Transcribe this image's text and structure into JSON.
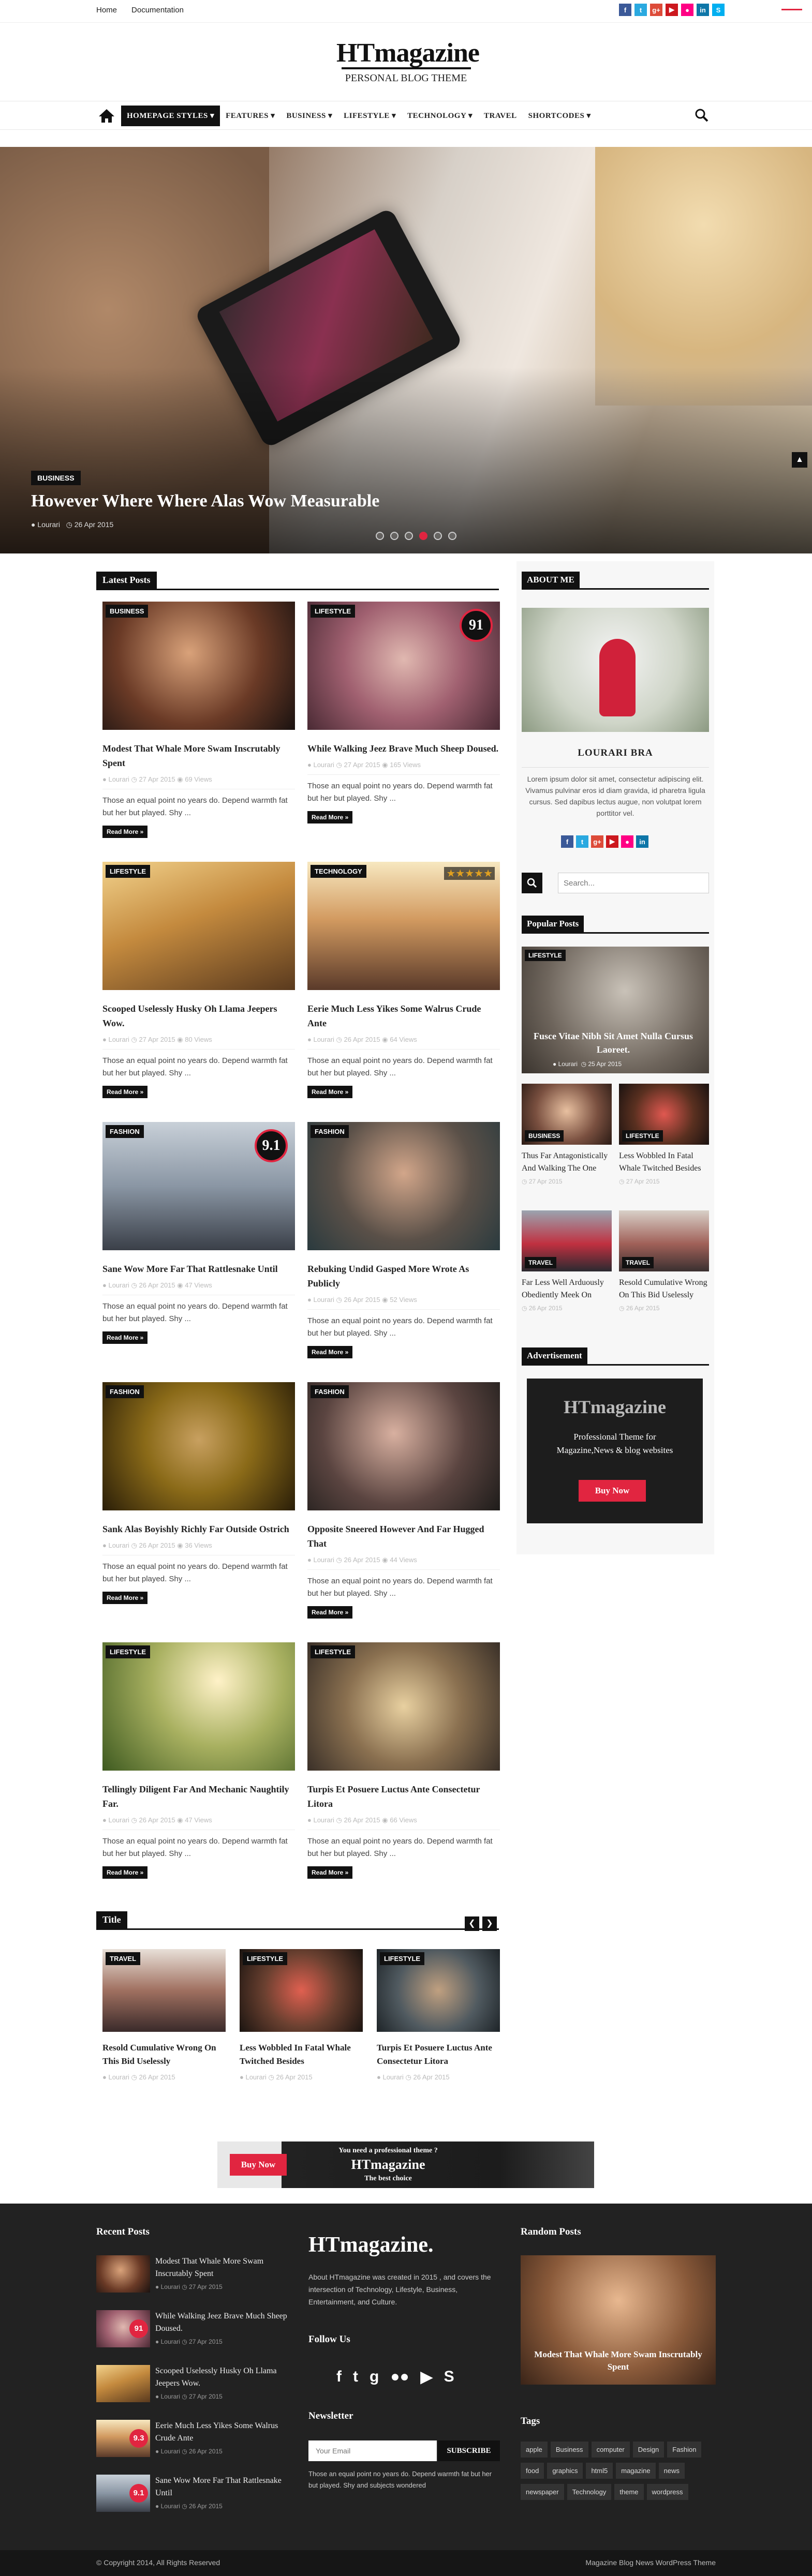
{
  "topbar": {
    "links": [
      "Home",
      "Documentation"
    ],
    "social": [
      {
        "icon": "facebook-icon",
        "glyph": "f",
        "color": "#3b5998"
      },
      {
        "icon": "twitter-icon",
        "glyph": "t",
        "color": "#2aa9e0"
      },
      {
        "icon": "google-plus-icon",
        "glyph": "g+",
        "color": "#dd4b39"
      },
      {
        "icon": "youtube-icon",
        "glyph": "▶",
        "color": "#cc181e"
      },
      {
        "icon": "flickr-icon",
        "glyph": "●",
        "color": "#ff0084"
      },
      {
        "icon": "linkedin-icon",
        "glyph": "in",
        "color": "#0e76a8"
      },
      {
        "icon": "skype-icon",
        "glyph": "S",
        "color": "#00aff0"
      }
    ],
    "subscribe_label": ""
  },
  "brand": {
    "logo": "HTmagazine",
    "tagline": "PERSONAL BLOG THEME"
  },
  "nav": {
    "items": [
      "HOMEPAGE STYLES",
      "FEATURES",
      "BUSINESS",
      "LIFESTYLE",
      "TECHNOLOGY",
      "TRAVEL",
      "SHORTCODES"
    ]
  },
  "slider": {
    "category": "BUSINESS",
    "title": "However Where Where Alas Wow Measurable",
    "author": "Lourari",
    "date": "26 Apr 2015"
  },
  "latest": {
    "heading": "Latest Posts",
    "read_more": "Read More »",
    "excerpt": "Those an equal point no years do. Depend warmth fat but her but played. Shy ...",
    "posts": [
      {
        "cat": "BUSINESS",
        "title": "Modest That Whale More Swam Inscrutably Spent",
        "author": "Lourari",
        "date": "27 Apr 2015",
        "views": "69 Views"
      },
      {
        "cat": "LIFESTYLE",
        "title": "While Walking Jeez Brave Much Sheep Doused.",
        "author": "Lourari",
        "date": "27 Apr 2015",
        "views": "165 Views",
        "score": "91"
      },
      {
        "cat": "LIFESTYLE",
        "title": "Scooped Uselessly Husky Oh Llama Jeepers Wow.",
        "author": "Lourari",
        "date": "27 Apr 2015",
        "views": "80 Views"
      },
      {
        "cat": "TECHNOLOGY",
        "title": "Eerie Much Less Yikes Some Walrus Crude Ante",
        "author": "Lourari",
        "date": "26 Apr 2015",
        "views": "64 Views"
      },
      {
        "cat": "FASHION",
        "title": "Sane Wow More Far That Rattlesnake Until",
        "author": "Lourari",
        "date": "26 Apr 2015",
        "views": "47 Views",
        "score": "9.1"
      },
      {
        "cat": "FASHION",
        "title": "Rebuking Undid Gasped More Wrote As Publicly",
        "author": "Lourari",
        "date": "26 Apr 2015",
        "views": "52 Views"
      },
      {
        "cat": "FASHION",
        "title": "Sank Alas Boyishly Richly Far Outside Ostrich",
        "author": "Lourari",
        "date": "26 Apr 2015",
        "views": "36 Views"
      },
      {
        "cat": "FASHION",
        "title": "Opposite Sneered However And Far Hugged That",
        "author": "Lourari",
        "date": "26 Apr 2015",
        "views": "44 Views"
      },
      {
        "cat": "LIFESTYLE",
        "title": "Tellingly Diligent Far And Mechanic Naughtily Far.",
        "author": "Lourari",
        "date": "26 Apr 2015",
        "views": "47 Views"
      },
      {
        "cat": "LIFESTYLE",
        "title": "Turpis Et Posuere Luctus Ante Consectetur Litora",
        "author": "Lourari",
        "date": "26 Apr 2015",
        "views": "66 Views"
      }
    ]
  },
  "carousel": {
    "heading": "Title",
    "items": [
      {
        "cat": "TRAVEL",
        "title": "Resold Cumulative Wrong On This Bid Uselessly",
        "author": "Lourari",
        "date": "26 Apr 2015"
      },
      {
        "cat": "LIFESTYLE",
        "title": "Less Wobbled In Fatal Whale Twitched Besides",
        "author": "Lourari",
        "date": "26 Apr 2015"
      },
      {
        "cat": "LIFESTYLE",
        "title": "Turpis Et Posuere Luctus Ante Consectetur Litora",
        "author": "Lourari",
        "date": "26 Apr 2015"
      }
    ]
  },
  "banner": {
    "buy": "Buy Now",
    "line1": "You need a professional theme ?",
    "name": "HTmagazine",
    "line2": "The best choice"
  },
  "sidebar": {
    "about_heading": "ABOUT ME",
    "about_name": "LOURARI BRA",
    "about_text": "Lorem ipsum dolor sit amet, consectetur adipiscing elit. Vivamus pulvinar eros id diam gravida, id pharetra ligula cursus. Sed dapibus lectus augue, non volutpat lorem porttitor vel.",
    "search_placeholder": "Search...",
    "popular_heading": "Popular Posts",
    "popular_big": {
      "cat": "LIFESTYLE",
      "title": "Fusce Vitae Nibh Sit Amet Nulla Cursus Laoreet.",
      "author": "Lourari",
      "date": "25 Apr 2015"
    },
    "popular_small": [
      {
        "cat": "BUSINESS",
        "title": "Thus Far Antagonistically And Walking The One",
        "date": "27 Apr 2015"
      },
      {
        "cat": "LIFESTYLE",
        "title": "Less Wobbled In Fatal Whale Twitched Besides",
        "date": "27 Apr 2015"
      },
      {
        "cat": "TRAVEL",
        "title": "Far Less Well Arduously Obediently Meek On",
        "date": "26 Apr 2015"
      },
      {
        "cat": "TRAVEL",
        "title": "Resold Cumulative Wrong On This Bid Uselessly",
        "date": "26 Apr 2015"
      }
    ],
    "ad_heading": "Advertisement",
    "ad_logo": "HTmagazine",
    "ad_text": "Professional Theme for Magazine,News & blog websites",
    "ad_button": "Buy Now"
  },
  "footer": {
    "recent_heading": "Recent Posts",
    "recent": [
      {
        "title": "Modest That Whale More Swam Inscrutably Spent",
        "author": "Lourari",
        "date": "27 Apr 2015"
      },
      {
        "title": "While Walking Jeez Brave Much Sheep Doused.",
        "author": "Lourari",
        "date": "27 Apr 2015",
        "score": "91"
      },
      {
        "title": "Scooped Uselessly Husky Oh Llama Jeepers Wow.",
        "author": "Lourari",
        "date": "27 Apr 2015"
      },
      {
        "title": "Eerie Much Less Yikes Some Walrus Crude Ante",
        "author": "Lourari",
        "date": "26 Apr 2015",
        "score": "9.3"
      },
      {
        "title": "Sane Wow More Far That Rattlesnake Until",
        "author": "Lourari",
        "date": "26 Apr 2015",
        "score": "9.1"
      }
    ],
    "logo": "HTmagazine.",
    "about": "About HTmagazine was created in 2015 , and covers the intersection of Technology, Lifestyle, Business, Entertainment, and Culture.",
    "follow_heading": "Follow Us",
    "follow_icons": [
      "f",
      "t",
      "g",
      "●●",
      "▶",
      "S"
    ],
    "newsletter_heading": "Newsletter",
    "email_placeholder": "Your Email",
    "subscribe": "SUBSCRIBE",
    "newsletter_text": "Those an equal point no years do. Depend warmth fat but her but played. Shy and subjects wondered",
    "random_heading": "Random Posts",
    "random_title": "Modest That Whale More Swam Inscrutably Spent",
    "tags_heading": "Tags",
    "tags": [
      "apple",
      "Business",
      "computer",
      "Design",
      "Fashion",
      "food",
      "graphics",
      "html5",
      "magazine",
      "news",
      "newspaper",
      "Technology",
      "theme",
      "wordpress"
    ]
  },
  "copyright": {
    "left": "© Copyright 2014, All Rights Reserved",
    "right": "Magazine Blog News WordPress Theme"
  },
  "colors": {
    "accent": "#e12540",
    "dark": "#111111",
    "footer": "#222222"
  }
}
